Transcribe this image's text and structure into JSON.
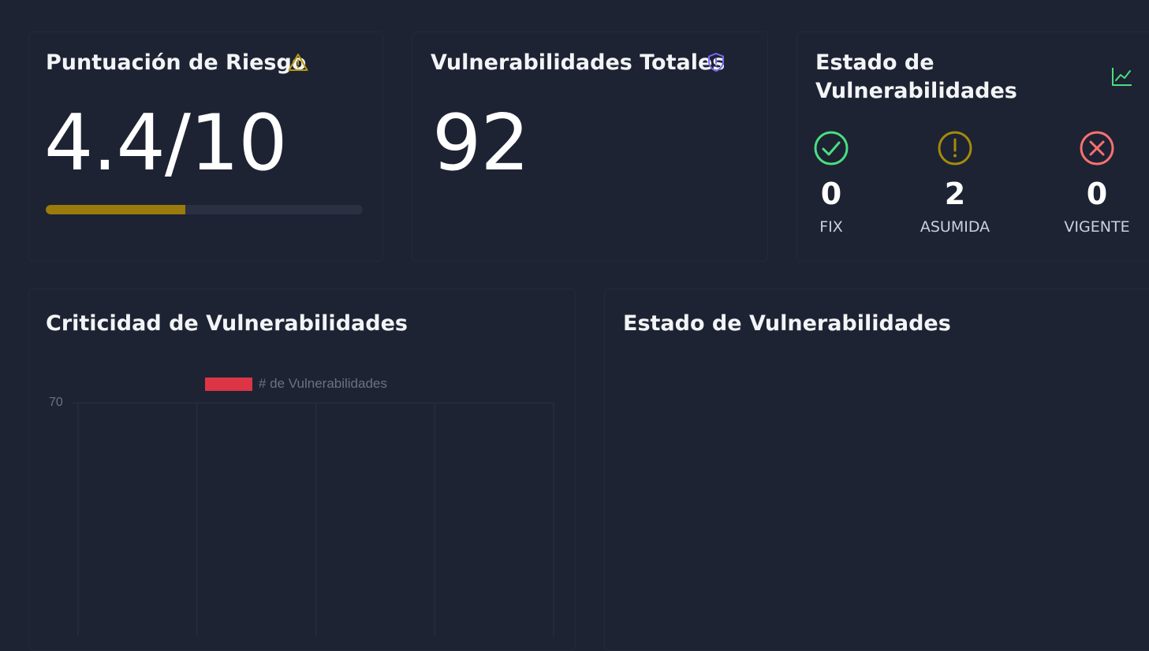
{
  "risk_card": {
    "title": "Puntuación de Riesgo",
    "icon": "warning-icon",
    "score_text": "4.4/10",
    "score": 4.4,
    "max": 10,
    "progress_fraction": 0.44,
    "accent_color": "#b8960c"
  },
  "total_card": {
    "title": "Vulnerabilidades Totales",
    "icon": "shield-alert-icon",
    "value": "92",
    "icon_color": "#7c6bf2"
  },
  "status_card": {
    "title_line1": "Estado de",
    "title_line2": "Vulnerabilidades",
    "icon": "line-chart-icon",
    "items": [
      {
        "icon": "check-circle-icon",
        "count": "0",
        "label": "FIX",
        "color": "#4ade80"
      },
      {
        "icon": "exclamation-circle-icon",
        "count": "2",
        "label": "ASUMIDA",
        "color": "#a58a0a"
      },
      {
        "icon": "x-circle-icon",
        "count": "0",
        "label": "VIGENTE",
        "color": "#f87171"
      }
    ]
  },
  "criticality_card": {
    "title": "Criticidad de Vulnerabilidades"
  },
  "status_chart_card": {
    "title": "Estado de Vulnerabilidades"
  },
  "chart_data": {
    "type": "bar",
    "title": "",
    "legend": [
      {
        "name": "# de Vulnerabilidades",
        "color": "#dc3545"
      }
    ],
    "legend_position": "top",
    "y_ticks_visible": [
      "70"
    ],
    "grid": true,
    "categories": [],
    "series": [
      {
        "name": "# de Vulnerabilidades",
        "values": []
      }
    ]
  }
}
